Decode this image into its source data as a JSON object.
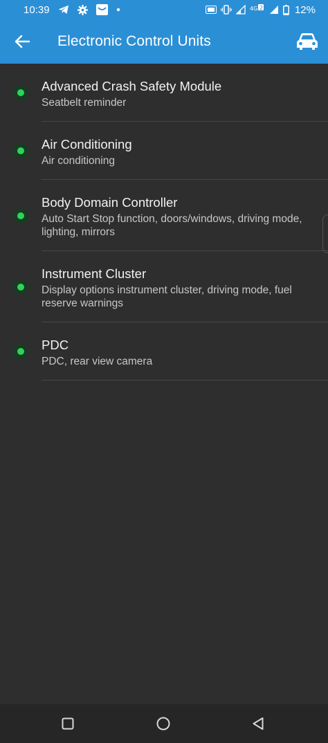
{
  "status_bar": {
    "time": "10:39",
    "battery": "12%",
    "icons": [
      "telegram-icon",
      "settings-icon",
      "mail-icon",
      "dot-icon",
      "hd-icon",
      "vibrate-icon",
      "signal-icon",
      "4g-icon",
      "signal-full-icon",
      "battery-icon"
    ]
  },
  "app_bar": {
    "title": "Electronic Control Units",
    "back_icon": "back-arrow-icon",
    "action_icon": "car-icon",
    "color": "#2b8fd6"
  },
  "ecus": [
    {
      "title": "Advanced Crash Safety Module",
      "description": "Seatbelt reminder",
      "status": "ok"
    },
    {
      "title": "Air Conditioning",
      "description": "Air conditioning",
      "status": "ok"
    },
    {
      "title": "Body Domain Controller",
      "description": "Auto Start Stop function, doors/windows, driving mode, lighting, mirrors",
      "status": "ok"
    },
    {
      "title": "Instrument Cluster",
      "description": "Display options instrument cluster, driving mode, fuel reserve warnings",
      "status": "ok"
    },
    {
      "title": "PDC",
      "description": "PDC, rear view camera",
      "status": "ok"
    }
  ],
  "status_color": "#2ed35a",
  "nav_bar": {
    "icons": [
      "recents-square-icon",
      "home-circle-icon",
      "back-triangle-icon"
    ]
  }
}
